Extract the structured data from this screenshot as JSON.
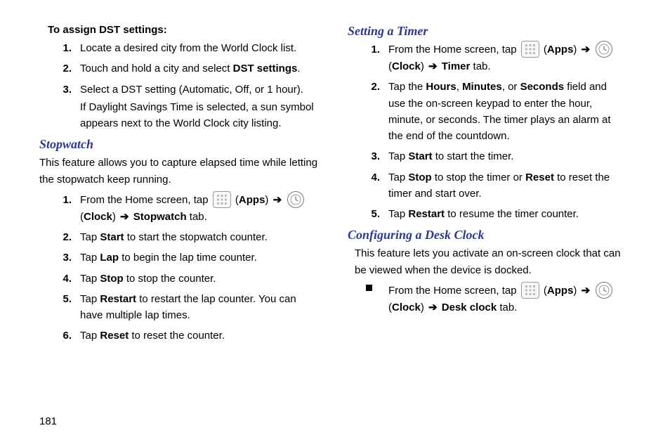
{
  "page_number": "181",
  "left": {
    "dst_heading": "To assign DST settings:",
    "dst_steps": {
      "n1": "1.",
      "s1": "Locate a desired city from the World Clock list.",
      "n2": "2.",
      "s2a": "Touch and hold a city and select ",
      "s2b": "DST settings",
      "s2c": ".",
      "n3": "3.",
      "s3a": "Select a DST setting (Automatic, Off, or 1 hour).",
      "s3b": "If Daylight Savings Time is selected, a sun symbol appears next to the World Clock city listing."
    },
    "stopwatch_heading": "Stopwatch",
    "stopwatch_intro": "This feature allows you to capture elapsed time while letting the stopwatch keep running.",
    "sw": {
      "n1": "1.",
      "s1a": "From the Home screen, tap ",
      "apps_label": "Apps",
      "clock_label": "Clock",
      "s1_tab_label": "Stopwatch",
      "s1_tab_suffix": " tab.",
      "n2": "2.",
      "s2a": "Tap ",
      "s2b": "Start",
      "s2c": " to start the stopwatch counter.",
      "n3": "3.",
      "s3a": "Tap ",
      "s3b": "Lap",
      "s3c": " to begin the lap time counter.",
      "n4": "4.",
      "s4a": "Tap ",
      "s4b": "Stop",
      "s4c": " to stop the counter.",
      "n5": "5.",
      "s5a": "Tap ",
      "s5b": "Restart",
      "s5c": " to restart the lap counter. You can have multiple lap times.",
      "n6": "6.",
      "s6a": "Tap ",
      "s6b": "Reset",
      "s6c": " to reset the counter."
    }
  },
  "right": {
    "timer_heading": "Setting a Timer",
    "tm": {
      "n1": "1.",
      "s1a": "From the Home screen, tap ",
      "apps_label": "Apps",
      "clock_label": "Clock",
      "s1_tab_label": "Timer",
      "s1_tab_suffix": " tab.",
      "n2": "2.",
      "s2a": "Tap the ",
      "s2b": "Hours",
      "s2c": ", ",
      "s2d": "Minutes",
      "s2e": ", or ",
      "s2f": "Seconds",
      "s2g": " field and use the on-screen keypad to enter the hour, minute, or seconds. The timer plays an alarm at the end of the countdown.",
      "n3": "3.",
      "s3a": "Tap ",
      "s3b": "Start",
      "s3c": " to start the timer.",
      "n4": "4.",
      "s4a": "Tap ",
      "s4b": "Stop",
      "s4c": " to stop the timer or ",
      "s4d": "Reset",
      "s4e": " to reset the timer and start over.",
      "n5": "5.",
      "s5a": "Tap ",
      "s5b": "Restart",
      "s5c": " to resume the timer counter."
    },
    "desk_heading": "Configuring a Desk Clock",
    "desk_intro": "This feature lets you activate an on-screen clock that can be viewed when the device is docked.",
    "dc": {
      "b1a": "From the Home screen, tap ",
      "apps_label": "Apps",
      "clock_label": "Clock",
      "b1_tab_label": "Desk clock",
      "b1_tab_suffix": " tab."
    }
  },
  "glyphs": {
    "arrow": "➔",
    "open_paren": "(",
    "close_paren": ")"
  }
}
